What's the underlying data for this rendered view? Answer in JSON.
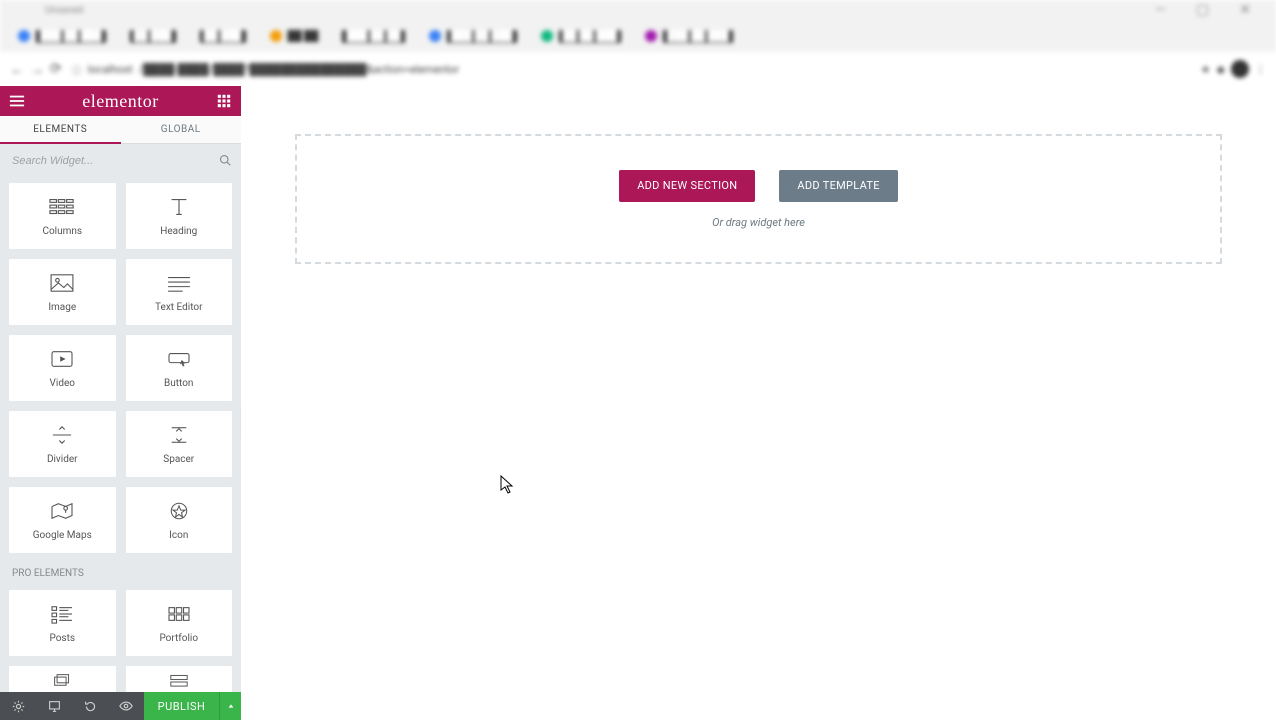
{
  "browser": {
    "title_hint": "Unsaved",
    "win_min": "—",
    "win_max": "▢",
    "win_close": "✕",
    "address": "localhost"
  },
  "header": {
    "logo_text": "elementor"
  },
  "tabs": {
    "elements": "ELEMENTS",
    "global": "GLOBAL"
  },
  "search": {
    "placeholder": "Search Widget..."
  },
  "widgets": {
    "basic": [
      {
        "id": "columns",
        "label": "Columns"
      },
      {
        "id": "heading",
        "label": "Heading"
      },
      {
        "id": "image",
        "label": "Image"
      },
      {
        "id": "text-editor",
        "label": "Text Editor"
      },
      {
        "id": "video",
        "label": "Video"
      },
      {
        "id": "button",
        "label": "Button"
      },
      {
        "id": "divider",
        "label": "Divider"
      },
      {
        "id": "spacer",
        "label": "Spacer"
      },
      {
        "id": "google-maps",
        "label": "Google Maps"
      },
      {
        "id": "icon",
        "label": "Icon"
      }
    ],
    "pro_heading": "PRO ELEMENTS",
    "pro": [
      {
        "id": "posts",
        "label": "Posts"
      },
      {
        "id": "portfolio",
        "label": "Portfolio"
      }
    ]
  },
  "footer": {
    "publish": "PUBLISH"
  },
  "canvas": {
    "add_section": "ADD NEW SECTION",
    "add_template": "ADD TEMPLATE",
    "drag_hint": "Or drag widget here"
  }
}
